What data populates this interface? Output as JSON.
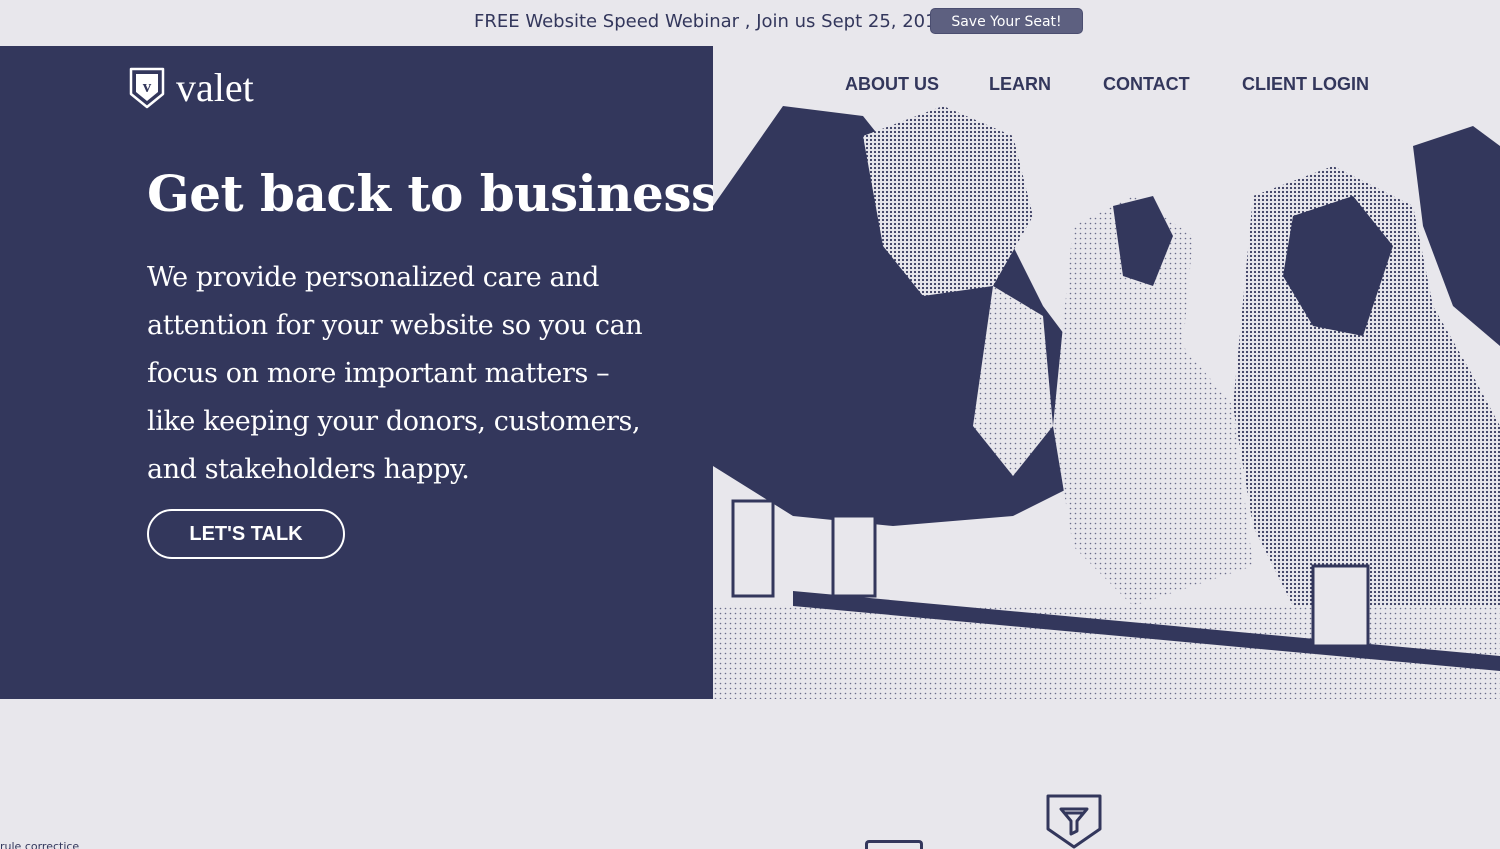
{
  "announcement": {
    "text": "FREE Website Speed Webinar , Join us Sept 25, 2019",
    "button_label": "Save Your Seat!"
  },
  "brand": {
    "logo_letter": "v",
    "name": "valet"
  },
  "nav": {
    "items": [
      "ABOUT US",
      "LEARN",
      "CONTACT",
      "CLIENT LOGIN"
    ]
  },
  "hero": {
    "headline": "Get back to business.",
    "body": "We provide personalized care and attention for your website so you can focus on more important matters – like keeping your donors, customers, and stakeholders happy.",
    "cta_label": "LET'S TALK"
  },
  "colors": {
    "navy": "#33375c",
    "background": "#e8e7ec",
    "white": "#ffffff"
  },
  "icons": {
    "logo": "shield-v-icon",
    "below_fold": "shield-funnel-icon"
  },
  "corner_text": "rule correctice"
}
